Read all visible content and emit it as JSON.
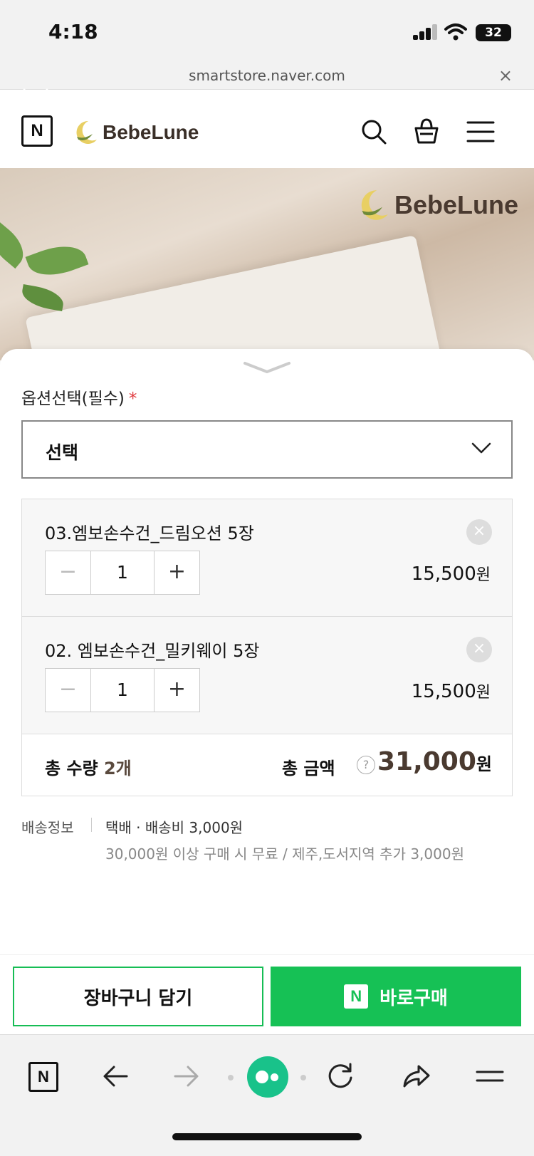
{
  "status_bar": {
    "time": "4:18",
    "battery": "32"
  },
  "browser": {
    "url": "smartstore.naver.com",
    "close_symbol": "×"
  },
  "header": {
    "n_logo": "N",
    "brand": "BebeLune"
  },
  "hero": {
    "brand": "BebeLune"
  },
  "option": {
    "label": "옵션선택(필수)",
    "required_mark": "*",
    "select_value": "선택"
  },
  "items": [
    {
      "name": "03.엠보손수건_드림오션 5장",
      "qty": "1",
      "price": "15,500",
      "currency": "원"
    },
    {
      "name": "02. 엠보손수건_밀키웨이 5장",
      "qty": "1",
      "price": "15,500",
      "currency": "원"
    }
  ],
  "stepper": {
    "minus": "−",
    "plus": "+"
  },
  "totals": {
    "qty_label": "총 수량",
    "qty_value": "2개",
    "amount_label": "총 금액",
    "help": "?",
    "amount": "31,000",
    "currency": "원"
  },
  "shipping": {
    "label": "배송정보",
    "method": "택배 · 배송비 3,000원",
    "note": "30,000원 이상 구매 시 무료 / 제주,도서지역 추가 3,000원"
  },
  "actions": {
    "cart": "장바구니 담기",
    "buy_mark": "N",
    "buy": "바로구매"
  },
  "nav": {
    "n_logo": "N"
  },
  "colors": {
    "accent_green": "#16c155",
    "brand_brown": "#4a3a30",
    "required_red": "#e0393e"
  }
}
